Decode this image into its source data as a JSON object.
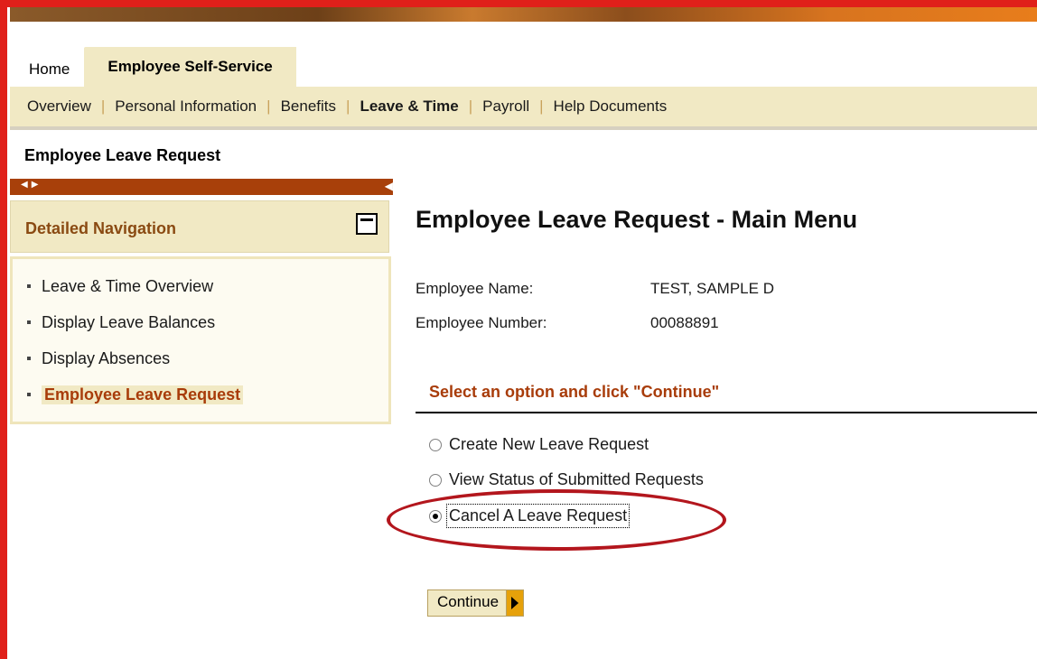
{
  "tabs": [
    {
      "label": "Home",
      "active": false
    },
    {
      "label": "Employee Self-Service",
      "active": true
    }
  ],
  "subnav": [
    {
      "label": "Overview",
      "current": false
    },
    {
      "label": "Personal Information",
      "current": false
    },
    {
      "label": "Benefits",
      "current": false
    },
    {
      "label": "Leave & Time",
      "current": true
    },
    {
      "label": "Payroll",
      "current": false
    },
    {
      "label": "Help Documents",
      "current": false
    }
  ],
  "page_label": "Employee Leave Request",
  "detailed_navigation": {
    "title": "Detailed Navigation",
    "items": [
      {
        "label": "Leave & Time Overview",
        "selected": false
      },
      {
        "label": "Display Leave Balances",
        "selected": false
      },
      {
        "label": "Display Absences",
        "selected": false
      },
      {
        "label": "Employee Leave Request",
        "selected": true
      }
    ]
  },
  "main": {
    "title": "Employee Leave Request - Main Menu",
    "employee_name_label": "Employee Name:",
    "employee_name": "TEST, SAMPLE D",
    "employee_number_label": "Employee Number:",
    "employee_number": "00088891",
    "prompt": "Select an option and click \"Continue\"",
    "options": [
      {
        "label": "Create New Leave Request",
        "checked": false
      },
      {
        "label": "View Status of Submitted Requests",
        "checked": false
      },
      {
        "label": "Cancel A Leave Request",
        "checked": true
      }
    ],
    "continue_label": "Continue"
  },
  "colors": {
    "frame": "#e0201a",
    "nav_bg": "#f1e9c4",
    "accent_brown": "#a8400a",
    "highlight_ellipse": "#b3161d"
  }
}
